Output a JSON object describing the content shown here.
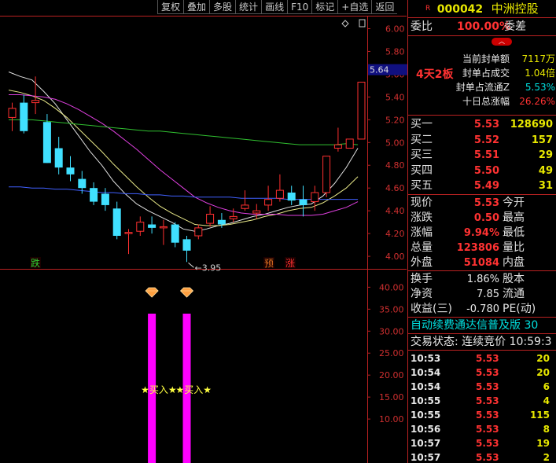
{
  "toolbar": [
    "复权",
    "叠加",
    "多股",
    "统计",
    "画线",
    "F10",
    "标记",
    "+自选",
    "返回"
  ],
  "header": {
    "badge": "R",
    "code": "000042",
    "name": "中洲控股"
  },
  "weibi": {
    "label": "委比",
    "value": "100.00%",
    "label2": "委差"
  },
  "board": {
    "tag": "4天2板",
    "rows": [
      {
        "label": "当前封单额",
        "value": "7117万"
      },
      {
        "label": "封单占成交",
        "value": "1.04倍"
      },
      {
        "label": "封单占流通Z",
        "value": "5.53%"
      },
      {
        "label": "十日总涨幅",
        "value": "26.26%"
      }
    ]
  },
  "buys": [
    {
      "label": "买一",
      "price": "5.53",
      "vol": "128690"
    },
    {
      "label": "买二",
      "price": "5.52",
      "vol": "157"
    },
    {
      "label": "买三",
      "price": "5.51",
      "vol": "29"
    },
    {
      "label": "买四",
      "price": "5.50",
      "vol": "49"
    },
    {
      "label": "买五",
      "price": "5.49",
      "vol": "31"
    }
  ],
  "quote": [
    {
      "l1": "现价",
      "v": "5.53",
      "l2": "今开"
    },
    {
      "l1": "涨跌",
      "v": "0.50",
      "l2": "最高"
    },
    {
      "l1": "涨幅",
      "v": "9.94%",
      "l2": "最低"
    },
    {
      "l1": "总量",
      "v": "123806",
      "l2": "量比"
    },
    {
      "l1": "外盘",
      "v": "51084",
      "l2": "内盘"
    }
  ],
  "fund": [
    {
      "l1": "换手",
      "v": "1.86%",
      "l2": "股本"
    },
    {
      "l1": "净资",
      "v": "7.85",
      "l2": "流通"
    },
    {
      "l1": "收益(三)",
      "v": "-0.780",
      "l2": "PE(动)"
    }
  ],
  "banner": "自动续费通达信普及版 30",
  "status": "交易状态: 连续竞价 10:59:3",
  "ticks": [
    {
      "t": "10:53",
      "p": "5.53",
      "v": "20"
    },
    {
      "t": "10:54",
      "p": "5.53",
      "v": "20"
    },
    {
      "t": "10:54",
      "p": "5.53",
      "v": "6"
    },
    {
      "t": "10:55",
      "p": "5.53",
      "v": "4"
    },
    {
      "t": "10:55",
      "p": "5.53",
      "v": "115"
    },
    {
      "t": "10:56",
      "p": "5.53",
      "v": "8"
    },
    {
      "t": "10:57",
      "p": "5.53",
      "v": "19"
    },
    {
      "t": "10:57",
      "p": "5.53",
      "v": "2"
    }
  ],
  "chart_data": {
    "type": "candlestick",
    "price_axis": {
      "ticks": [
        6.0,
        5.8,
        5.6,
        5.4,
        5.2,
        5.0,
        4.8,
        4.6,
        4.4,
        4.2,
        4.0
      ],
      "range": [
        3.89,
        6.1
      ]
    },
    "current_price_tag": "5.64",
    "low_annotation": "3.95",
    "markers": [
      "跌",
      "预",
      "涨"
    ],
    "candles": [
      {
        "o": 5.22,
        "h": 5.35,
        "l": 5.1,
        "c": 5.3
      },
      {
        "o": 5.35,
        "h": 5.42,
        "l": 5.08,
        "c": 5.1
      },
      {
        "o": 5.35,
        "h": 5.58,
        "l": 5.25,
        "c": 5.37
      },
      {
        "o": 5.18,
        "h": 5.25,
        "l": 4.82,
        "c": 4.82
      },
      {
        "o": 4.95,
        "h": 5.05,
        "l": 4.72,
        "c": 4.78
      },
      {
        "o": 4.78,
        "h": 4.88,
        "l": 4.66,
        "c": 4.72
      },
      {
        "o": 4.68,
        "h": 4.75,
        "l": 4.55,
        "c": 4.6
      },
      {
        "o": 4.6,
        "h": 4.65,
        "l": 4.45,
        "c": 4.48
      },
      {
        "o": 4.55,
        "h": 4.6,
        "l": 4.4,
        "c": 4.45
      },
      {
        "o": 4.42,
        "h": 4.48,
        "l": 4.15,
        "c": 4.18
      },
      {
        "o": 4.2,
        "h": 4.24,
        "l": 4.02,
        "c": 4.21
      },
      {
        "o": 4.22,
        "h": 4.35,
        "l": 4.18,
        "c": 4.3
      },
      {
        "o": 4.28,
        "h": 4.35,
        "l": 4.2,
        "c": 4.25
      },
      {
        "o": 4.25,
        "h": 4.32,
        "l": 4.1,
        "c": 4.26
      },
      {
        "o": 4.28,
        "h": 4.3,
        "l": 4.08,
        "c": 4.12
      },
      {
        "o": 4.15,
        "h": 4.18,
        "l": 3.95,
        "c": 4.05
      },
      {
        "o": 4.18,
        "h": 4.28,
        "l": 4.15,
        "c": 4.25
      },
      {
        "o": 4.29,
        "h": 4.44,
        "l": 4.26,
        "c": 4.37
      },
      {
        "o": 4.32,
        "h": 4.38,
        "l": 4.25,
        "c": 4.28
      },
      {
        "o": 4.33,
        "h": 4.42,
        "l": 4.3,
        "c": 4.35
      },
      {
        "o": 4.42,
        "h": 4.58,
        "l": 4.4,
        "c": 4.45
      },
      {
        "o": 4.38,
        "h": 4.46,
        "l": 4.33,
        "c": 4.4
      },
      {
        "o": 4.45,
        "h": 4.62,
        "l": 4.4,
        "c": 4.5
      },
      {
        "o": 4.51,
        "h": 4.72,
        "l": 4.48,
        "c": 4.58
      },
      {
        "o": 4.56,
        "h": 4.62,
        "l": 4.45,
        "c": 4.49
      },
      {
        "o": 4.5,
        "h": 4.62,
        "l": 4.35,
        "c": 4.45
      },
      {
        "o": 4.48,
        "h": 4.62,
        "l": 4.4,
        "c": 4.56
      },
      {
        "o": 4.56,
        "h": 4.88,
        "l": 4.52,
        "c": 4.88
      },
      {
        "o": 4.95,
        "h": 5.13,
        "l": 4.92,
        "c": 4.98
      },
      {
        "o": 4.95,
        "h": 5.02,
        "l": 4.95,
        "c": 5.03
      },
      {
        "o": 5.03,
        "h": 5.53,
        "l": 5.03,
        "c": 5.53
      }
    ],
    "ma_series": [
      {
        "color": "#e0e0e0",
        "values": [
          5.62,
          5.58,
          5.55,
          5.45,
          5.34,
          5.2,
          5.06,
          4.92,
          4.8,
          4.66,
          4.55,
          4.46,
          4.4,
          4.35,
          4.3,
          4.24,
          4.22,
          4.24,
          4.27,
          4.29,
          4.32,
          4.35,
          4.37,
          4.4,
          4.43,
          4.45,
          4.46,
          4.53,
          4.64,
          4.78,
          4.95
        ]
      },
      {
        "color": "#e8e888",
        "values": [
          5.46,
          5.44,
          5.41,
          5.37,
          5.3,
          5.22,
          5.12,
          5.02,
          4.92,
          4.81,
          4.71,
          4.61,
          4.52,
          4.44,
          4.38,
          4.33,
          4.28,
          4.27,
          4.27,
          4.28,
          4.3,
          4.32,
          4.35,
          4.37,
          4.4,
          4.42,
          4.43,
          4.47,
          4.53,
          4.6,
          4.7
        ]
      },
      {
        "color": "#e040e0",
        "values": [
          5.42,
          5.42,
          5.41,
          5.4,
          5.38,
          5.34,
          5.29,
          5.23,
          5.17,
          5.1,
          5.02,
          4.94,
          4.85,
          4.76,
          4.68,
          4.6,
          4.52,
          4.47,
          4.43,
          4.4,
          4.38,
          4.37,
          4.37,
          4.37,
          4.36,
          4.36,
          4.36,
          4.37,
          4.4,
          4.43,
          4.48
        ]
      },
      {
        "color": "#30c030",
        "values": [
          5.2,
          5.2,
          5.2,
          5.19,
          5.18,
          5.17,
          5.16,
          5.15,
          5.14,
          5.13,
          5.12,
          5.11,
          5.1,
          5.1,
          5.09,
          5.08,
          5.07,
          5.06,
          5.05,
          5.04,
          5.03,
          5.02,
          5.01,
          5.0,
          4.99,
          4.98,
          4.98,
          4.98,
          4.98,
          4.99,
          4.98
        ]
      },
      {
        "color": "#4060ff",
        "values": [
          4.61,
          4.61,
          4.6,
          4.6,
          4.59,
          4.59,
          4.58,
          4.57,
          4.56,
          4.56,
          4.55,
          4.55,
          4.54,
          4.54,
          4.53,
          4.53,
          4.52,
          4.52,
          4.52,
          4.52,
          4.51,
          4.51,
          4.51,
          4.51,
          4.5,
          4.5,
          4.5,
          4.5,
          4.5,
          4.5,
          4.5
        ]
      }
    ],
    "indicator": {
      "axis_ticks": [
        40.0,
        35.0,
        30.0,
        25.0,
        20.0,
        15.0,
        10.0
      ],
      "range": [
        0,
        44
      ],
      "signal_bars": [
        12,
        15
      ],
      "signal_text": "买入"
    }
  }
}
